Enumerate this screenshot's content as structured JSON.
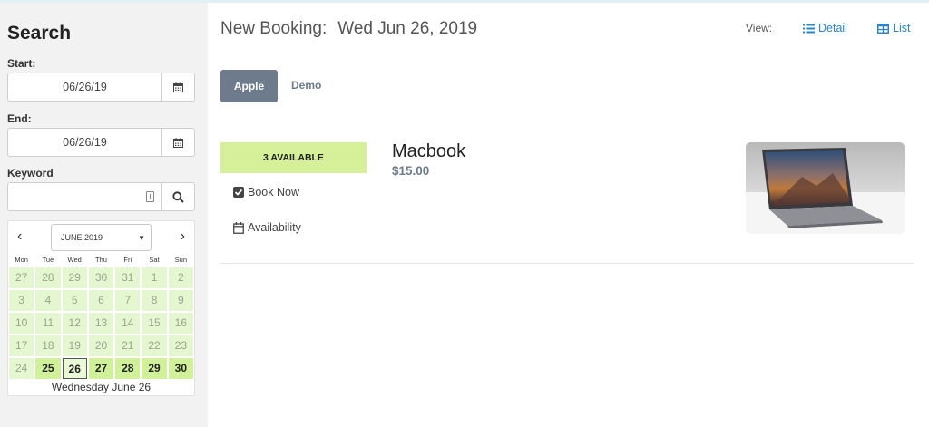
{
  "sidebar": {
    "title": "Search",
    "start_label": "Start:",
    "start_value": "06/26/19",
    "end_label": "End:",
    "end_value": "06/26/19",
    "keyword_label": "Keyword",
    "keyword_value": "",
    "calendar": {
      "month_select": "JUNE 2019",
      "weekdays": [
        "Mon",
        "Tue",
        "Wed",
        "Thu",
        "Fri",
        "Sat",
        "Sun"
      ],
      "rows": [
        [
          "27",
          "28",
          "29",
          "30",
          "31",
          "1",
          "2"
        ],
        [
          "3",
          "4",
          "5",
          "6",
          "7",
          "8",
          "9"
        ],
        [
          "10",
          "11",
          "12",
          "13",
          "14",
          "15",
          "16"
        ],
        [
          "17",
          "18",
          "19",
          "20",
          "21",
          "22",
          "23"
        ],
        [
          "24",
          "25",
          "26",
          "27",
          "28",
          "29",
          "30"
        ]
      ],
      "available_days": [
        "25",
        "26",
        "27",
        "28",
        "29",
        "30"
      ],
      "selected_day": "26",
      "footer": "Wednesday June 26"
    }
  },
  "main": {
    "title": "New Booking:",
    "date": "Wed Jun 26, 2019",
    "view_label": "View:",
    "view_detail": "Detail",
    "view_list": "List",
    "tabs": [
      {
        "label": "Apple",
        "active": true
      },
      {
        "label": "Demo",
        "active": false
      }
    ],
    "product": {
      "availability": "3 AVAILABLE",
      "name": "Macbook",
      "price": "$15.00",
      "book_now": "Book Now",
      "availability_link": "Availability"
    }
  },
  "colors": {
    "accent_link": "#2a86c9",
    "tab_active": "#6d7b8c",
    "available_green": "#d6f09a",
    "calendar_green": "#e5f7d0"
  }
}
